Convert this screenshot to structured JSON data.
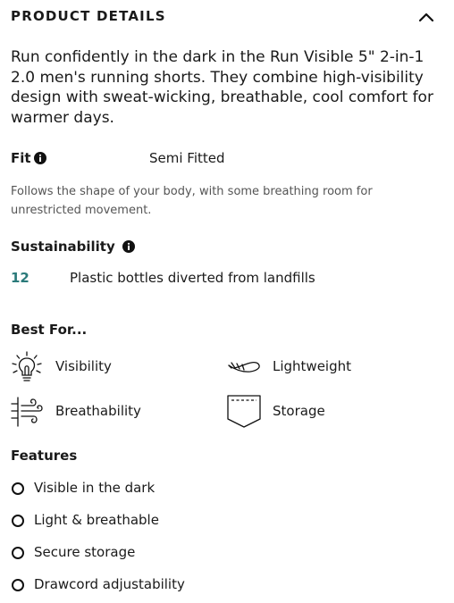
{
  "header": {
    "title": "PRODUCT DETAILS",
    "toggle_icon": "chevron-up-icon"
  },
  "description": "Run confidently in the dark in the Run Visible 5\" 2-in-1 2.0 men's running shorts. They combine high-visibility design with sweat-wicking, breathable, cool comfort for warmer days.",
  "fit": {
    "label": "Fit",
    "value": "Semi Fitted",
    "description": "Follows the shape of your body, with some breathing room for unrestricted movement.",
    "info_icon": "info-icon"
  },
  "sustainability": {
    "label": "Sustainability",
    "info_icon": "info-icon",
    "count": "12",
    "count_color": "#2a7a7a",
    "text": "Plastic bottles diverted from landfills"
  },
  "best_for": {
    "label": "Best For...",
    "items": [
      {
        "label": "Visibility",
        "icon": "lightbulb-icon"
      },
      {
        "label": "Lightweight",
        "icon": "feather-icon"
      },
      {
        "label": "Breathability",
        "icon": "wind-icon"
      },
      {
        "label": "Storage",
        "icon": "pocket-icon"
      }
    ]
  },
  "features": {
    "label": "Features",
    "items": [
      "Visible in the dark",
      "Light & breathable",
      "Secure storage",
      "Drawcord adjustability"
    ]
  }
}
